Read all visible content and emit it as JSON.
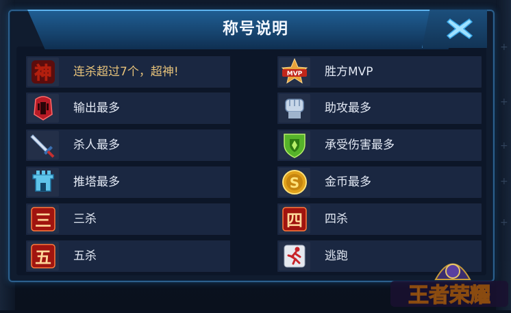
{
  "title": "称号说明",
  "close": {
    "icon": "close-icon"
  },
  "left_items": [
    {
      "icon": "god-char-icon",
      "label": "连杀超过7个，超神!",
      "highlight": true,
      "icon_text": "神"
    },
    {
      "icon": "helmet-icon",
      "label": "输出最多"
    },
    {
      "icon": "sword-icon",
      "label": "杀人最多"
    },
    {
      "icon": "tower-icon",
      "label": "推塔最多"
    },
    {
      "icon": "three-char-icon",
      "label": "三杀",
      "icon_text": "三"
    },
    {
      "icon": "five-char-icon",
      "label": "五杀",
      "icon_text": "五"
    }
  ],
  "right_items": [
    {
      "icon": "mvp-star-icon",
      "label": "胜方MVP",
      "icon_text": "MVP"
    },
    {
      "icon": "fist-icon",
      "label": "助攻最多"
    },
    {
      "icon": "shield-icon",
      "label": "承受伤害最多"
    },
    {
      "icon": "gold-coin-icon",
      "label": "金币最多",
      "icon_text": "S"
    },
    {
      "icon": "four-char-icon",
      "label": "四杀",
      "icon_text": "四"
    },
    {
      "icon": "runner-icon",
      "label": "逃跑"
    }
  ],
  "logo": {
    "icon": "game-logo-icon",
    "text": "王者荣耀"
  },
  "colors": {
    "accent": "#2c5f8c",
    "highlight": "#e6c27a",
    "panel": "#101c2f"
  }
}
